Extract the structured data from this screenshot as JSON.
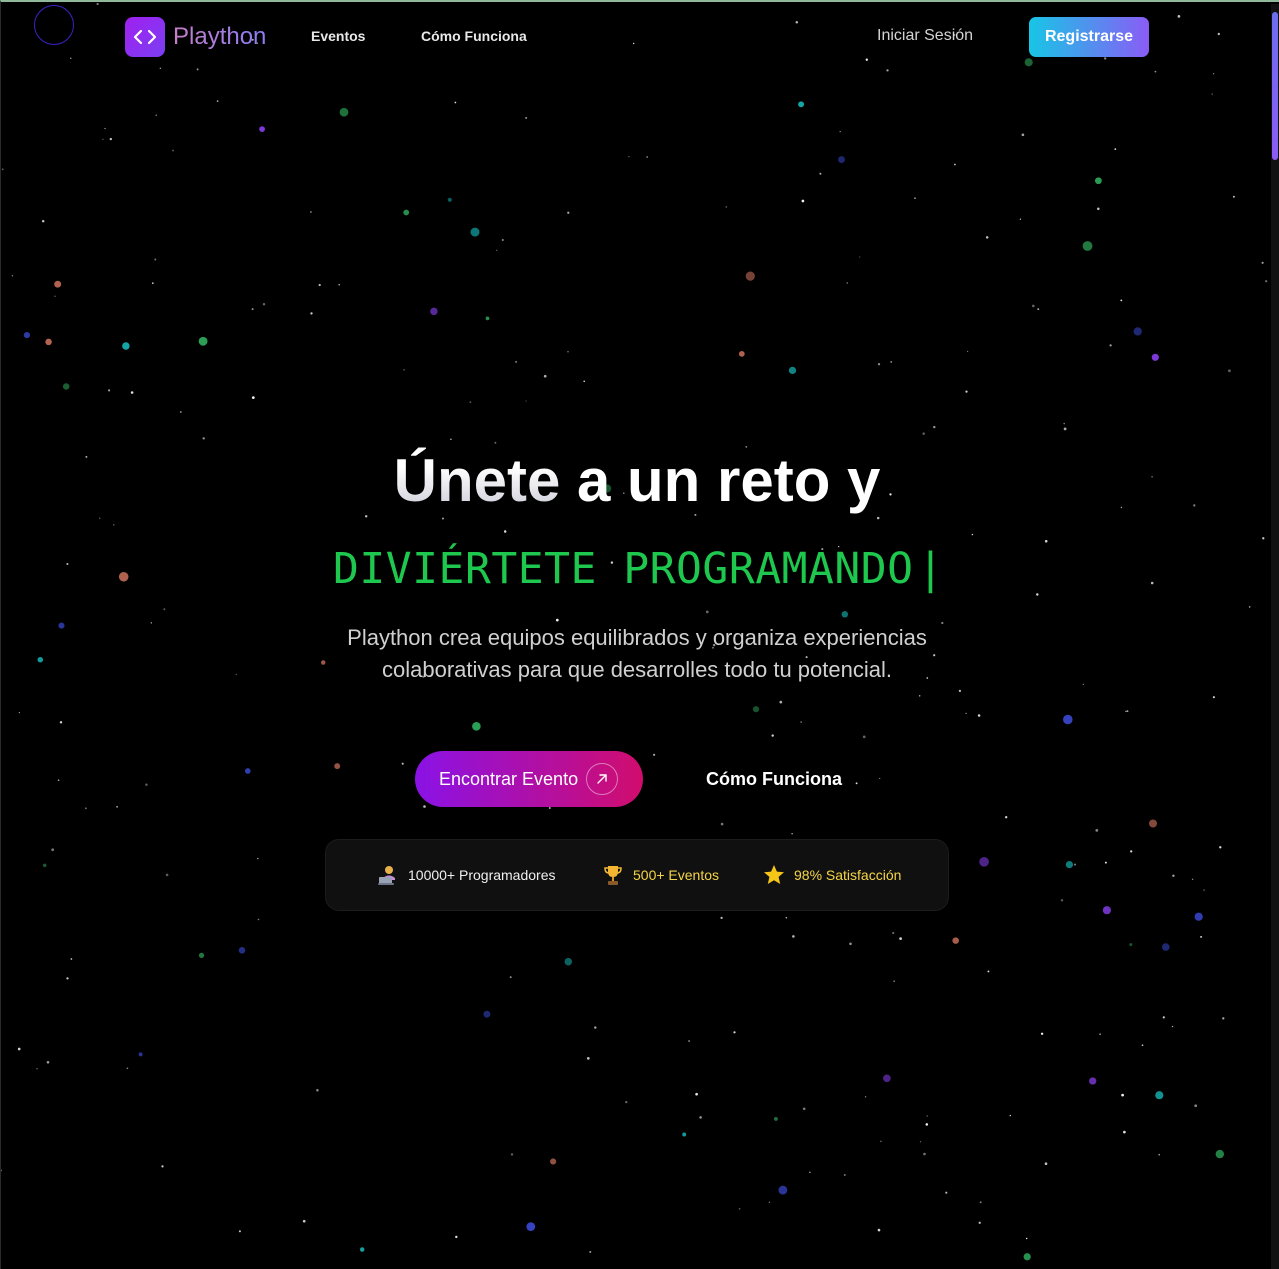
{
  "brand": {
    "name": "Plaython",
    "logo_icon": "code-brackets-icon",
    "accent": "#a020f0"
  },
  "nav": {
    "items": [
      {
        "label": "Eventos"
      },
      {
        "label": "Cómo Funciona"
      }
    ],
    "login_label": "Iniciar Sesión",
    "register_label": "Registrarse"
  },
  "hero": {
    "title_highlight": "Únete",
    "title_rest": " a un reto y",
    "subtitle": "DIVIÉRTETE PROGRAMANDO",
    "caret": "|",
    "subtitle_color": "#1ec84e",
    "description": "Plaython crea equipos equilibrados y organiza experiencias colaborativas para que desarrolles todo tu potencial.",
    "cta_primary": "Encontrar Evento",
    "cta_primary_icon": "arrow-up-right-icon",
    "cta_secondary": "Cómo Funciona"
  },
  "stats": [
    {
      "icon": "programmer-icon",
      "label": "10000+ Programadores"
    },
    {
      "icon": "trophy-icon",
      "label": "500+ Eventos"
    },
    {
      "icon": "star-icon",
      "label": "98% Satisfacción"
    }
  ],
  "background": {
    "color": "#000000",
    "particle_colors": [
      "#8a3ff0",
      "#16b3b3",
      "#2ea85a",
      "#c9705a",
      "#3b4bd8",
      "#ffffff"
    ]
  }
}
